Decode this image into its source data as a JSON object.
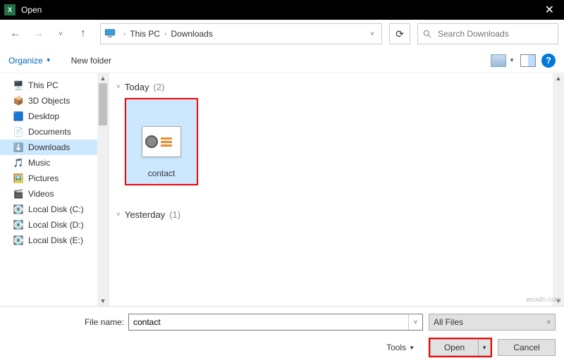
{
  "titlebar": {
    "app": "X",
    "title": "Open"
  },
  "nav": {
    "breadcrumb": {
      "root_icon": "pc-icon",
      "items": [
        "This PC",
        "Downloads"
      ]
    },
    "search_placeholder": "Search Downloads"
  },
  "toolbar": {
    "organize": "Organize",
    "new_folder": "New folder"
  },
  "sidebar": {
    "items": [
      {
        "icon": "pc",
        "label": "This PC",
        "selected": false
      },
      {
        "icon": "3d",
        "label": "3D Objects",
        "selected": false
      },
      {
        "icon": "desktop",
        "label": "Desktop",
        "selected": false
      },
      {
        "icon": "docs",
        "label": "Documents",
        "selected": false
      },
      {
        "icon": "downloads",
        "label": "Downloads",
        "selected": true
      },
      {
        "icon": "music",
        "label": "Music",
        "selected": false
      },
      {
        "icon": "pictures",
        "label": "Pictures",
        "selected": false
      },
      {
        "icon": "videos",
        "label": "Videos",
        "selected": false
      },
      {
        "icon": "disk",
        "label": "Local Disk (C:)",
        "selected": false
      },
      {
        "icon": "disk",
        "label": "Local Disk (D:)",
        "selected": false
      },
      {
        "icon": "disk",
        "label": "Local Disk (E:)",
        "selected": false
      }
    ]
  },
  "content": {
    "groups": [
      {
        "title": "Today",
        "count": "(2)",
        "files": [
          {
            "name": "contact",
            "icon": "vcard"
          }
        ]
      },
      {
        "title": "Yesterday",
        "count": "(1)",
        "files": []
      }
    ]
  },
  "bottom": {
    "file_label": "File name:",
    "file_value": "contact",
    "filter": "All Files",
    "tools": "Tools",
    "open": "Open",
    "cancel": "Cancel"
  },
  "watermark": "wsxdn.com"
}
